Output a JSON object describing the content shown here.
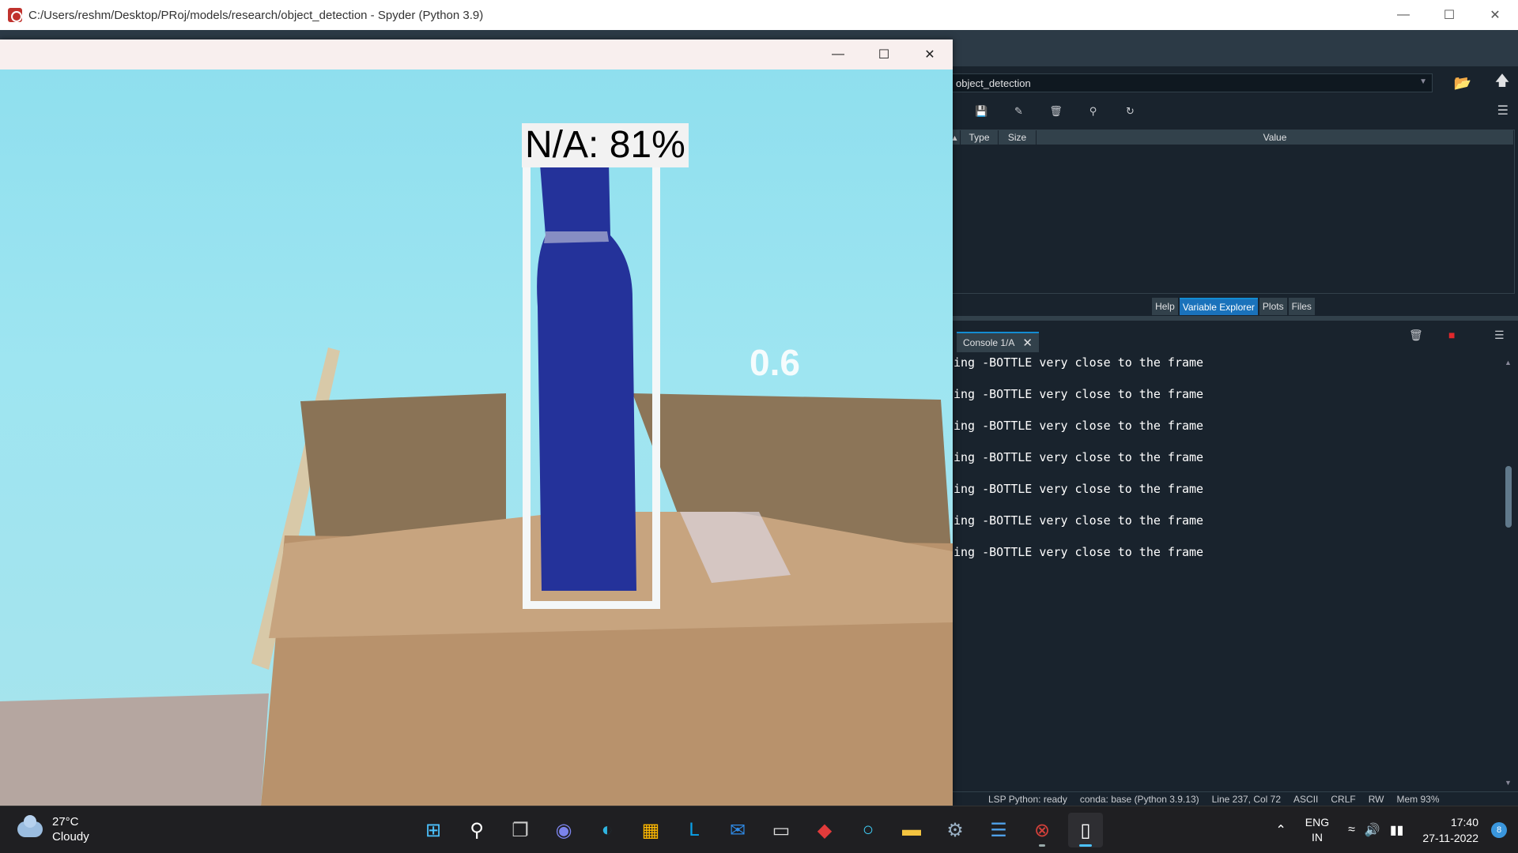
{
  "spyder": {
    "title": "C:/Users/reshm/Desktop/PRoj/models/research/object_detection - Spyder (Python 3.9)",
    "path": "object_detection",
    "variable_explorer": {
      "columns": [
        "Type",
        "Size",
        "Value"
      ]
    },
    "pane_tabs": [
      {
        "label": "Help",
        "active": false
      },
      {
        "label": "Variable Explorer",
        "active": true
      },
      {
        "label": "Plots",
        "active": false
      },
      {
        "label": "Files",
        "active": false
      }
    ],
    "console": {
      "tab_label": "Console 1/A",
      "lines": [
        "ing -BOTTLE very close to the frame",
        "ing -BOTTLE very close to the frame",
        "ing -BOTTLE very close to the frame",
        "ing -BOTTLE very close to the frame",
        "ing -BOTTLE very close to the frame",
        "ing -BOTTLE very close to the frame",
        "ing -BOTTLE very close to the frame"
      ]
    },
    "statusbar": {
      "lsp": "LSP Python: ready",
      "conda": "conda: base (Python 3.9.13)",
      "position": "Line 237, Col 72",
      "encoding": "ASCII",
      "eol": "CRLF",
      "mode": "RW",
      "memory": "Mem 93%"
    }
  },
  "detection": {
    "label": "N/A: 81%",
    "score_text": "0.6"
  },
  "taskbar": {
    "weather": {
      "temp": "27°C",
      "condition": "Cloudy"
    },
    "apps": [
      {
        "name": "start",
        "glyph": "⊞",
        "color": "#4cc2ff",
        "active": false,
        "running": false
      },
      {
        "name": "search",
        "glyph": "⚲",
        "color": "#ffffff",
        "active": false,
        "running": false
      },
      {
        "name": "task-view",
        "glyph": "❐",
        "color": "#cccccc",
        "active": false,
        "running": false
      },
      {
        "name": "chat",
        "glyph": "◉",
        "color": "#7b83eb",
        "active": false,
        "running": false
      },
      {
        "name": "edge",
        "glyph": "◐",
        "color": "#2fb4e0",
        "active": false,
        "running": false
      },
      {
        "name": "store",
        "glyph": "▦",
        "color": "#ffb900",
        "active": false,
        "running": false
      },
      {
        "name": "l-app",
        "glyph": "L",
        "color": "#0aa0e8",
        "active": false,
        "running": false
      },
      {
        "name": "mail",
        "glyph": "✉",
        "color": "#2f8be8",
        "active": false,
        "running": false
      },
      {
        "name": "terminal",
        "glyph": "▭",
        "color": "#dddddd",
        "active": false,
        "running": false
      },
      {
        "name": "mcafee",
        "glyph": "◆",
        "color": "#e23b3b",
        "active": false,
        "running": false
      },
      {
        "name": "cortana",
        "glyph": "○",
        "color": "#3ec8f0",
        "active": false,
        "running": false
      },
      {
        "name": "file-explorer",
        "glyph": "▬",
        "color": "#f3c340",
        "active": false,
        "running": false
      },
      {
        "name": "settings",
        "glyph": "⚙",
        "color": "#9ab0c4",
        "active": false,
        "running": false
      },
      {
        "name": "notepad",
        "glyph": "☰",
        "color": "#4fa0e8",
        "active": false,
        "running": false
      },
      {
        "name": "spyder",
        "glyph": "⊗",
        "color": "#d2403a",
        "active": false,
        "running": true
      },
      {
        "name": "document",
        "glyph": "▯",
        "color": "#ffffff",
        "active": true,
        "running": true
      }
    ],
    "tray": {
      "lang_top": "ENG",
      "lang_bottom": "IN",
      "time": "17:40",
      "date": "27-11-2022",
      "notifications": "8"
    }
  }
}
